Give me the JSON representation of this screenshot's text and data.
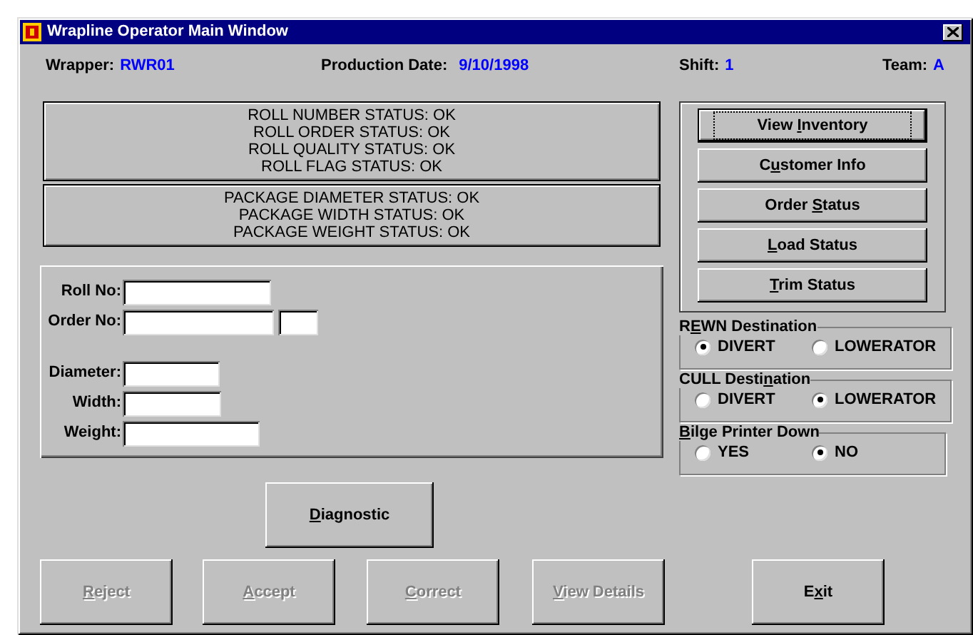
{
  "window": {
    "title": "Wrapline Operator Main Window"
  },
  "header": [
    {
      "label": "Wrapper:",
      "value": "RWR01"
    },
    {
      "label": "Production Date:",
      "value": "9/10/1998"
    },
    {
      "label": "Shift:",
      "value": "1"
    },
    {
      "label": "Team:",
      "value": "A"
    }
  ],
  "roll_status": [
    "ROLL NUMBER STATUS: OK",
    "ROLL ORDER STATUS: OK",
    "ROLL QUALITY STATUS: OK",
    "ROLL FLAG STATUS: OK"
  ],
  "package_status": [
    "PACKAGE DIAMETER STATUS: OK",
    "PACKAGE WIDTH STATUS: OK",
    "PACKAGE WEIGHT STATUS: OK"
  ],
  "roll_fields": [
    {
      "label": "Roll No:",
      "kind": "single"
    },
    {
      "label": "Order No:",
      "kind": "double"
    }
  ],
  "package_fields": [
    {
      "label": "Diameter:",
      "kind": "single"
    },
    {
      "label": "Width:",
      "kind": "single"
    },
    {
      "label": "Weight:",
      "kind": "single"
    }
  ],
  "diagnostic_button": {
    "label_parts": [
      {
        "text": "D",
        "underlined": true
      },
      {
        "text": "iagnostic",
        "underlined": false
      }
    ]
  },
  "side_buttons": [
    {
      "label_parts": [
        {
          "text": "View ",
          "underlined": false
        },
        {
          "text": "I",
          "underlined": true
        },
        {
          "text": "nventory",
          "underlined": false
        }
      ],
      "focused": true
    },
    {
      "label_parts": [
        {
          "text": "C",
          "underlined": false
        },
        {
          "text": "u",
          "underlined": true
        },
        {
          "text": "stomer Info",
          "underlined": false
        }
      ],
      "focused": false
    },
    {
      "label_parts": [
        {
          "text": "Order ",
          "underlined": false
        },
        {
          "text": "S",
          "underlined": true
        },
        {
          "text": "tatus",
          "underlined": false
        }
      ],
      "focused": false
    },
    {
      "label_parts": [
        {
          "text": "L",
          "underlined": true
        },
        {
          "text": "oad Status",
          "underlined": false
        }
      ],
      "focused": false
    },
    {
      "label_parts": [
        {
          "text": "T",
          "underlined": true
        },
        {
          "text": "rim Status",
          "underlined": false
        }
      ],
      "focused": false
    }
  ],
  "radio_groups": [
    {
      "title_parts": [
        {
          "text": "R",
          "underlined": false
        },
        {
          "text": "E",
          "underlined": true
        },
        {
          "text": "WN Destination",
          "underlined": false
        }
      ],
      "options": [
        {
          "label": "DIVERT",
          "selected": true
        },
        {
          "label": "LOWERATOR",
          "selected": false
        }
      ]
    },
    {
      "title_parts": [
        {
          "text": "CULL Desti",
          "underlined": false
        },
        {
          "text": "n",
          "underlined": true
        },
        {
          "text": "ation",
          "underlined": false
        }
      ],
      "options": [
        {
          "label": "DIVERT",
          "selected": false
        },
        {
          "label": "LOWERATOR",
          "selected": true
        }
      ]
    },
    {
      "title_parts": [
        {
          "text": "B",
          "underlined": true
        },
        {
          "text": "ilge Printer Down",
          "underlined": false
        }
      ],
      "options": [
        {
          "label": "YES",
          "selected": false
        },
        {
          "label": "NO",
          "selected": true
        }
      ]
    }
  ],
  "bottom_buttons": [
    {
      "label_parts": [
        {
          "text": "R",
          "underlined": true
        },
        {
          "text": "eject",
          "underlined": false
        }
      ],
      "disabled": true
    },
    {
      "label_parts": [
        {
          "text": "A",
          "underlined": true
        },
        {
          "text": "ccept",
          "underlined": false
        }
      ],
      "disabled": true
    },
    {
      "label_parts": [
        {
          "text": "C",
          "underlined": true
        },
        {
          "text": "orrect",
          "underlined": false
        }
      ],
      "disabled": true
    },
    {
      "label_parts": [
        {
          "text": "V",
          "underlined": true
        },
        {
          "text": "iew Details",
          "underlined": false
        }
      ],
      "disabled": true
    },
    {
      "label_parts": [
        {
          "text": "E",
          "underlined": false
        },
        {
          "text": "x",
          "underlined": true
        },
        {
          "text": "it",
          "underlined": false
        }
      ],
      "disabled": false
    }
  ]
}
